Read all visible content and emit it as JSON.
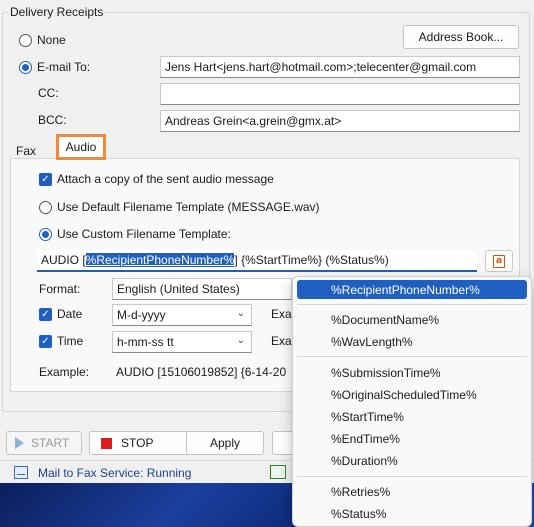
{
  "group_title": "Delivery Receipts",
  "radio": {
    "none_label": "None",
    "email_label": "E-mail To:",
    "selected": "E-mail To:"
  },
  "buttons": {
    "address_book": "Address Book...",
    "start": "START",
    "stop": "STOP",
    "apply": "Apply"
  },
  "fields": {
    "email_to": "Jens Hart<jens.hart@hotmail.com>;telecenter@gmail.com",
    "cc_label": "CC:",
    "cc": "",
    "bcc_label": "BCC:",
    "bcc": "Andreas Grein<a.grein@gmx.at>"
  },
  "tabs": [
    {
      "label": "Fax",
      "active": false
    },
    {
      "label": "Audio",
      "active": true
    }
  ],
  "audio": {
    "attach_label": "Attach a copy of the sent audio message",
    "attach_checked": true,
    "default_template_label": "Use Default Filename Template (MESSAGE.wav)",
    "custom_template_label": "Use Custom Filename Template:",
    "template_selected_option": "Use Custom Filename Template:",
    "template": {
      "prefix": "AUDIO [",
      "selected": "%RecipientPhoneNumber%",
      "suffix": "] {%StartTime%} (%Status%)"
    },
    "format_label": "Format:",
    "format_value": "English (United States)",
    "date_label": "Date",
    "date_checked": true,
    "date_value": "M-d-yyyy",
    "date_example_label": "Exa",
    "time_label": "Time",
    "time_checked": true,
    "time_value": "h-mm-ss tt",
    "time_example_label": "Exa",
    "example_label": "Example:",
    "example_value": "AUDIO [15106019852] {6-14-20"
  },
  "variables_menu": {
    "highlighted": "%RecipientPhoneNumber%",
    "groups": [
      [
        "%RecipientPhoneNumber%"
      ],
      [
        "%DocumentName%",
        "%WavLength%"
      ],
      [
        "%SubmissionTime%",
        "%OriginalScheduledTime%",
        "%StartTime%",
        "%EndTime%",
        "%Duration%"
      ],
      [
        "%Retries%",
        "%Status%"
      ]
    ]
  },
  "status_bar": {
    "service_text": "Mail to Fax Service: Running"
  },
  "colors": {
    "accent": "#1f5fbf",
    "tab_highlight": "#f0883e",
    "stop_red": "#e01b1b",
    "status_link": "#1f3f8f"
  }
}
